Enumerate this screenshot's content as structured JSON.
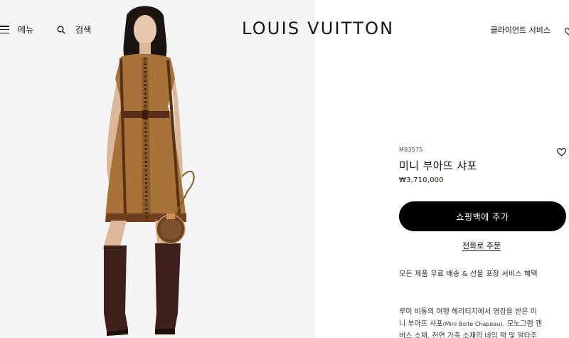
{
  "header": {
    "menu_label": "메뉴",
    "search_label": "검색",
    "logo": "LOUIS VUITTON",
    "client_service": "클라이언트 서비스"
  },
  "product": {
    "sku": "M83575",
    "name": "미니 부아뜨 샤포",
    "price": "₩3,710,000",
    "add_to_bag": "쇼핑백에 추가",
    "phone_order": "전화로 주문",
    "services": "모든 제품 무료 배송 & 선물 포장 서비스 혜택",
    "description": {
      "line1": "루이 비통의 여행 헤리티지에서 영감을 받은 미",
      "line2_prefix": "니 부아뜨 샤포",
      "line2_small": "(Mini Boite Chapeau)",
      "line2_suffix": ". 모노그램 캔",
      "line3": "버스 소재, 천연 가죽 소재의 네임 택 및 말타주"
    }
  },
  "colors": {
    "accent": "#000000",
    "text": "#19110b",
    "photo_bg": "#f3f3f3",
    "dress": "#a8733a",
    "boots": "#3d1f1c"
  },
  "icons": {
    "menu": "hamburger-icon",
    "search": "search-icon",
    "wishlist": "heart-icon"
  }
}
